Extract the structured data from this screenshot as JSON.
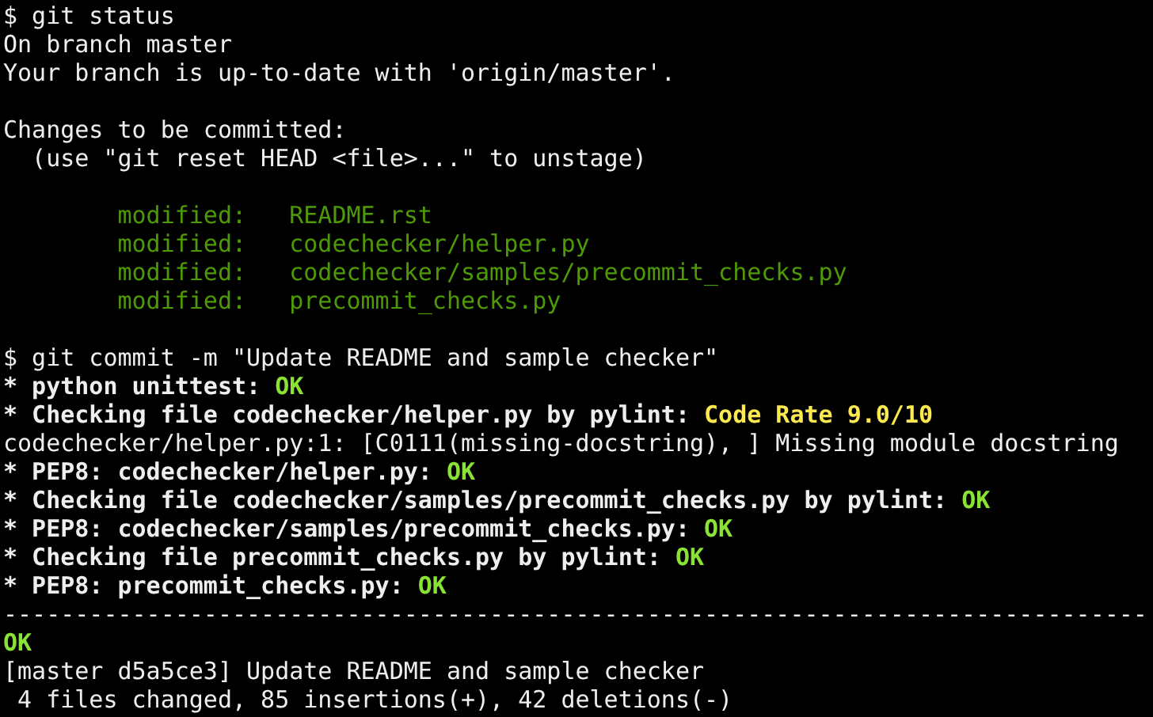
{
  "terminal": {
    "lines": [
      {
        "kind": "text",
        "segments": [
          {
            "kind": "plain",
            "text": "$ git status"
          }
        ]
      },
      {
        "kind": "text",
        "segments": [
          {
            "kind": "plain",
            "text": "On branch master"
          }
        ]
      },
      {
        "kind": "text",
        "segments": [
          {
            "kind": "plain",
            "text": "Your branch is up-to-date with 'origin/master'."
          }
        ]
      },
      {
        "kind": "blank"
      },
      {
        "kind": "text",
        "segments": [
          {
            "kind": "plain",
            "text": "Changes to be committed:"
          }
        ]
      },
      {
        "kind": "text",
        "segments": [
          {
            "kind": "plain",
            "text": "  (use \"git reset HEAD <file>...\" to unstage)"
          }
        ]
      },
      {
        "kind": "blank"
      },
      {
        "kind": "text",
        "segments": [
          {
            "kind": "staged",
            "text": "        modified:   README.rst"
          }
        ]
      },
      {
        "kind": "text",
        "segments": [
          {
            "kind": "staged",
            "text": "        modified:   codechecker/helper.py"
          }
        ]
      },
      {
        "kind": "text",
        "segments": [
          {
            "kind": "staged",
            "text": "        modified:   codechecker/samples/precommit_checks.py"
          }
        ]
      },
      {
        "kind": "text",
        "segments": [
          {
            "kind": "staged",
            "text": "        modified:   precommit_checks.py"
          }
        ]
      },
      {
        "kind": "blank"
      },
      {
        "kind": "text",
        "segments": [
          {
            "kind": "plain",
            "text": "$ git commit -m \"Update README and sample checker\""
          }
        ]
      },
      {
        "kind": "text",
        "segments": [
          {
            "kind": "heading",
            "text": "* python unittest: "
          },
          {
            "kind": "ok",
            "text": "OK"
          }
        ]
      },
      {
        "kind": "text",
        "segments": [
          {
            "kind": "heading",
            "text": "* Checking file codechecker/helper.py by pylint: "
          },
          {
            "kind": "warning",
            "text": "Code Rate 9.0/10"
          }
        ]
      },
      {
        "kind": "text",
        "segments": [
          {
            "kind": "plain",
            "text": "codechecker/helper.py:1: [C0111(missing-docstring), ] Missing module docstring"
          }
        ]
      },
      {
        "kind": "text",
        "segments": [
          {
            "kind": "heading",
            "text": "* PEP8: codechecker/helper.py: "
          },
          {
            "kind": "ok",
            "text": "OK"
          }
        ]
      },
      {
        "kind": "text",
        "segments": [
          {
            "kind": "heading",
            "text": "* Checking file codechecker/samples/precommit_checks.py by pylint: "
          },
          {
            "kind": "ok",
            "text": "OK"
          }
        ]
      },
      {
        "kind": "text",
        "segments": [
          {
            "kind": "heading",
            "text": "* PEP8: codechecker/samples/precommit_checks.py: "
          },
          {
            "kind": "ok",
            "text": "OK"
          }
        ]
      },
      {
        "kind": "text",
        "segments": [
          {
            "kind": "heading",
            "text": "* Checking file precommit_checks.py by pylint: "
          },
          {
            "kind": "ok",
            "text": "OK"
          }
        ]
      },
      {
        "kind": "text",
        "segments": [
          {
            "kind": "heading",
            "text": "* PEP8: precommit_checks.py: "
          },
          {
            "kind": "ok",
            "text": "OK"
          }
        ]
      },
      {
        "kind": "text",
        "segments": [
          {
            "kind": "plain",
            "text": "--------------------------------------------------------------------------------"
          }
        ]
      },
      {
        "kind": "text",
        "segments": [
          {
            "kind": "ok",
            "text": "OK"
          }
        ]
      },
      {
        "kind": "text",
        "segments": [
          {
            "kind": "plain",
            "text": "[master d5a5ce3] Update README and sample checker"
          }
        ]
      },
      {
        "kind": "text",
        "segments": [
          {
            "kind": "plain",
            "text": " 4 files changed, 85 insertions(+), 42 deletions(-)"
          }
        ]
      }
    ]
  }
}
